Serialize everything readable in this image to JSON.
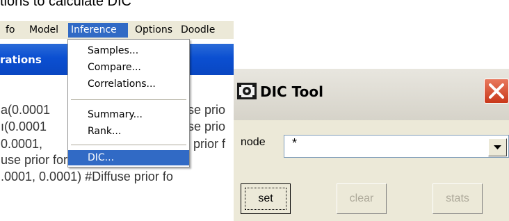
{
  "caption": "tions to calculate DIC",
  "menubar": {
    "items": [
      "fo",
      "Model",
      "Inference",
      "Options",
      "Doodle"
    ],
    "active": "Inference"
  },
  "window": {
    "title_fragment": "rations"
  },
  "code_lines": [
    "a(0.0001",
    "ı(0.0001",
    "0.0001,",
    "use prior for mu",
    ".0001, 0.0001) #Diffuse prior fo"
  ],
  "code_fragments": [
    "se prio",
    "se prio",
    "prior f"
  ],
  "inference_menu": {
    "items": [
      "Samples...",
      "Compare...",
      "Correlations...",
      "Summary...",
      "Rank...",
      "DIC..."
    ],
    "highlighted": "DIC..."
  },
  "dic_tool": {
    "title": "DIC Tool",
    "node_label": "node",
    "node_value": "*",
    "buttons": {
      "set": "set",
      "clear": "clear",
      "stats": "stats"
    }
  },
  "colors": {
    "menu_highlight": "#316ac5",
    "titlebar_blue": "#0b4fd1",
    "close_red": "#d7462a",
    "disabled_text": "#aca899"
  }
}
